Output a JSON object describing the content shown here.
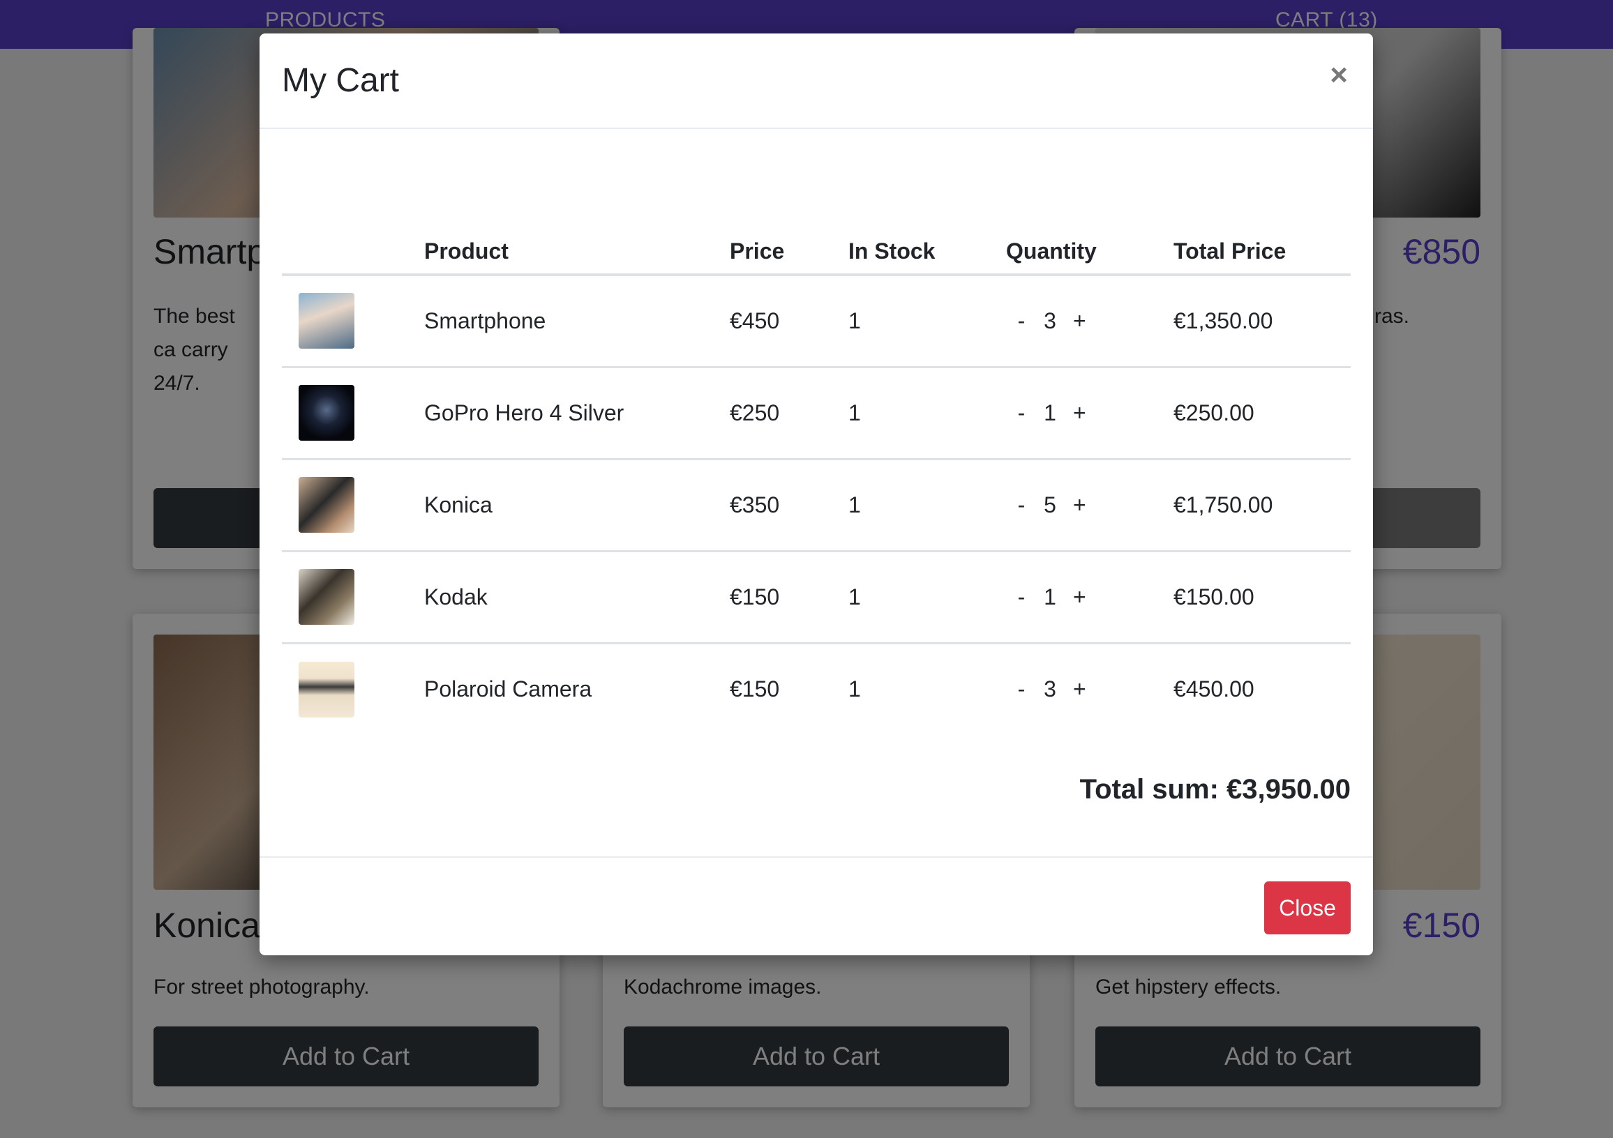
{
  "navbar": {
    "products_label": "PRODUCTS",
    "cart_label": "CART (13)"
  },
  "background_cards": [
    {
      "title": "Smartp",
      "description": "The best ca carry 24/7.",
      "button": ""
    },
    {
      "title": "",
      "price": "€850",
      "description": "ras.",
      "button": ""
    },
    {
      "title": "Konica",
      "description": "For street photography.",
      "button": "Add to Cart"
    },
    {
      "title": "",
      "description": "Kodachrome images.",
      "button": "Add to Cart"
    },
    {
      "title": "",
      "price": "€150",
      "description": "Get hipstery effects.",
      "button": "Add to Cart"
    }
  ],
  "modal": {
    "title": "My Cart",
    "close_icon": "×",
    "columns": [
      "",
      "Product",
      "Price",
      "In Stock",
      "Quantity",
      "Total Price"
    ],
    "items": [
      {
        "thumb": "smartphone",
        "product": "Smartphone",
        "price": "€450",
        "in_stock": "1",
        "qty_minus": "-",
        "quantity": "3",
        "qty_plus": "+",
        "total": "€1,350.00"
      },
      {
        "thumb": "gopro",
        "product": "GoPro Hero 4 Silver",
        "price": "€250",
        "in_stock": "1",
        "qty_minus": "-",
        "quantity": "1",
        "qty_plus": "+",
        "total": "€250.00"
      },
      {
        "thumb": "konica",
        "product": "Konica",
        "price": "€350",
        "in_stock": "1",
        "qty_minus": "-",
        "quantity": "5",
        "qty_plus": "+",
        "total": "€1,750.00"
      },
      {
        "thumb": "kodak",
        "product": "Kodak",
        "price": "€150",
        "in_stock": "1",
        "qty_minus": "-",
        "quantity": "1",
        "qty_plus": "+",
        "total": "€150.00"
      },
      {
        "thumb": "polaroid",
        "product": "Polaroid Camera",
        "price": "€150",
        "in_stock": "1",
        "qty_minus": "-",
        "quantity": "3",
        "qty_plus": "+",
        "total": "€450.00"
      }
    ],
    "total_sum": "Total sum: €3,950.00",
    "close_button": "Close"
  },
  "colors": {
    "brand": "#5a3ecb",
    "danger": "#dc3545",
    "dark_button": "#343a40"
  }
}
